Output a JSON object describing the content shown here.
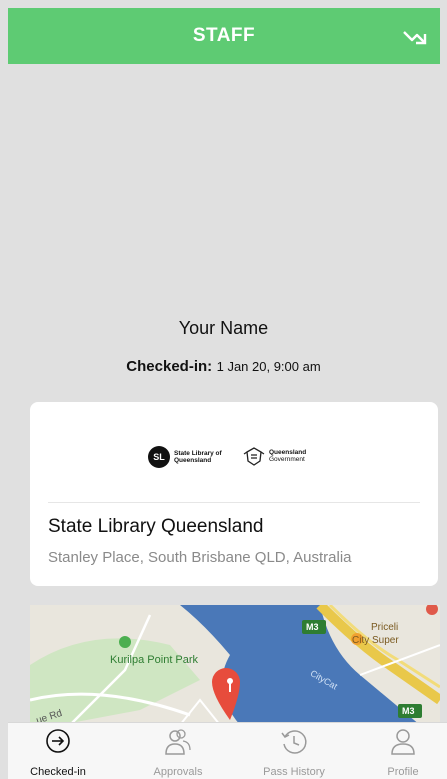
{
  "header": {
    "title": "STAFF",
    "icon": "trend-arrow-icon"
  },
  "user": {
    "name": "Your Name",
    "checked_in_label": "Checked-in:",
    "checked_in_value": "1 Jan 20, 9:00 am"
  },
  "card": {
    "logo_sl_initials": "SL",
    "logo_sl_text": "State Library of Queensland",
    "logo_qld_text_1": "Queensland",
    "logo_qld_text_2": "Government",
    "place_name": "State Library Queensland",
    "address": "Stanley Place, South Brisbane QLD, Australia"
  },
  "map": {
    "park_label": "Kurilpa Point Park",
    "road_label": "ue Rd",
    "river_label": "CityCat",
    "shop_label": "City Super",
    "shop2_label": "Priceli",
    "badge1": "M3",
    "badge2": "M3",
    "pin_icon": "location-pin-icon"
  },
  "tabs": [
    {
      "label": "Checked-in",
      "icon": "arrow-circle-icon",
      "active": true
    },
    {
      "label": "Approvals",
      "icon": "users-icon",
      "active": false
    },
    {
      "label": "Pass History",
      "icon": "history-icon",
      "active": false
    },
    {
      "label": "Profile",
      "icon": "person-icon",
      "active": false
    }
  ],
  "colors": {
    "header_green": "#5ecb73",
    "pin_red": "#e74c3c",
    "river_blue": "#4a78b8"
  }
}
